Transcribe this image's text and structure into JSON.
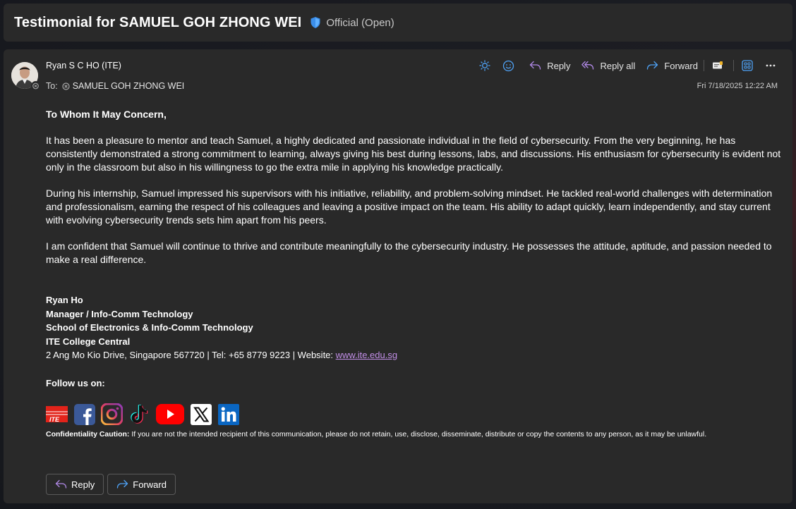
{
  "header": {
    "subject": "Testimonial for SAMUEL GOH ZHONG WEI",
    "sensitivity_label": "Official (Open)"
  },
  "message": {
    "sender": "Ryan S C HO (ITE)",
    "to_label": "To:",
    "recipient": "SAMUEL GOH ZHONG WEI",
    "timestamp": "Fri 7/18/2025 12:22 AM"
  },
  "toolbar": {
    "reply_label": "Reply",
    "reply_all_label": "Reply all",
    "forward_label": "Forward"
  },
  "body": {
    "greeting": "To Whom It May Concern,",
    "paragraphs": [
      "It has been a pleasure to mentor and teach Samuel, a highly dedicated and passionate individual in the field of cybersecurity. From the very beginning, he has consistently demonstrated a strong commitment to learning, always giving his best during lessons, labs, and discussions. His enthusiasm for cybersecurity is evident not only in the classroom but also in his willingness to go the extra mile in applying his knowledge practically.",
      "During his internship, Samuel impressed his supervisors with his initiative, reliability, and problem-solving mindset. He tackled real-world challenges with determination and professionalism, earning the respect of his colleagues and leaving a positive impact on the team. His ability to adapt quickly, learn independently, and stay current with evolving cybersecurity trends sets him apart from his peers.",
      "I am confident that Samuel will continue to thrive and contribute meaningfully to the cybersecurity industry. He possesses the attitude, aptitude, and passion needed to make a real difference."
    ]
  },
  "signature": {
    "name": "Ryan Ho",
    "title": "Manager / Info-Comm Technology",
    "school": "School of Electronics & Info-Comm Technology",
    "college": "ITE College Central",
    "address": "2 Ang Mo Kio Drive, Singapore 567720 | Tel: +65 8779 9223 | Website: ",
    "website": "www.ite.edu.sg",
    "follow": "Follow us on:",
    "confidentiality_label": "Confidentiality Caution:",
    "confidentiality_text": " If you are not the intended recipient of this communication, please do not retain, use, disclose, disseminate, distribute or copy the contents to any person, as it may be unlawful.",
    "social_icons": [
      "ite-logo",
      "facebook-icon",
      "instagram-icon",
      "tiktok-icon",
      "youtube-icon",
      "x-icon",
      "linkedin-icon"
    ]
  },
  "footer": {
    "reply_label": "Reply",
    "forward_label": "Forward"
  },
  "colors": {
    "accent_blue": "#4fa3f7",
    "reply_purple": "#b088e6",
    "link": "#c18ee6"
  }
}
